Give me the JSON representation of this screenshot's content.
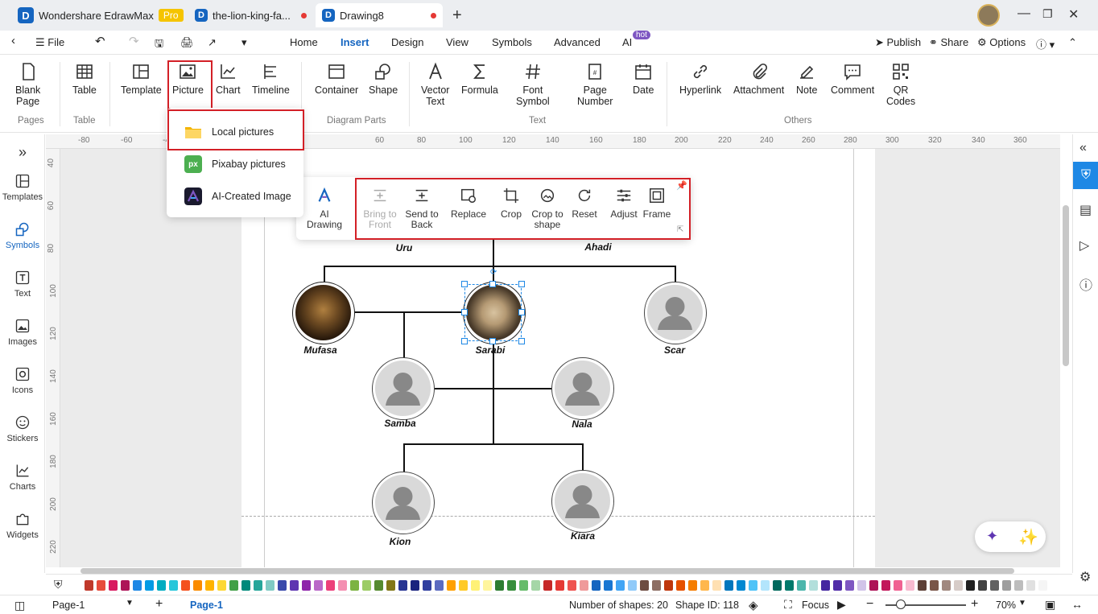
{
  "titlebar": {
    "tabs": [
      {
        "label": "Wondershare EdrawMax",
        "badge": "Pro"
      },
      {
        "label": "the-lion-king-fa..."
      },
      {
        "label": "Drawing8"
      }
    ],
    "add_tab": "+"
  },
  "menubar": {
    "file": "File",
    "items": [
      "Home",
      "Insert",
      "Design",
      "View",
      "Symbols",
      "Advanced",
      "AI"
    ],
    "ai_badge": "hot",
    "publish": "Publish",
    "share": "Share",
    "options": "Options"
  },
  "ribbon": {
    "buttons": {
      "blank_page": "Blank\nPage",
      "table": "Table",
      "template": "Template",
      "picture": "Picture",
      "chart": "Chart",
      "timeline": "Timeline",
      "container": "Container",
      "shape": "Shape",
      "vector_text": "Vector\nText",
      "formula": "Formula",
      "font_symbol": "Font\nSymbol",
      "page_number": "Page\nNumber",
      "date": "Date",
      "hyperlink": "Hyperlink",
      "attachment": "Attachment",
      "note": "Note",
      "comment": "Comment",
      "qr_codes": "QR\nCodes"
    },
    "groups": {
      "pages": "Pages",
      "table": "Table",
      "diagram_parts": "Diagram Parts",
      "text": "Text",
      "others": "Others"
    }
  },
  "picture_menu": {
    "items": [
      "Local pictures",
      "Pixabay pictures",
      "AI-Created Image"
    ]
  },
  "context_toolbar": {
    "ai_drawing": "AI Drawing",
    "bring_to_front": "Bring to\nFront",
    "send_to_back": "Send to\nBack",
    "replace": "Replace",
    "crop": "Crop",
    "crop_to_shape": "Crop to\nshape",
    "reset": "Reset",
    "adjust": "Adjust",
    "frame": "Frame"
  },
  "ruler": {
    "h_ticks": [
      "-80",
      "-60",
      "-4",
      "60",
      "80",
      "100",
      "120",
      "140",
      "160",
      "180",
      "200",
      "220",
      "240",
      "260",
      "280",
      "300",
      "320",
      "340",
      "360"
    ],
    "v_ticks": [
      "40",
      "60",
      "80",
      "100",
      "120",
      "140",
      "160",
      "180",
      "200",
      "220"
    ]
  },
  "left_sidebar": [
    "Templates",
    "Symbols",
    "Text",
    "Images",
    "Icons",
    "Stickers",
    "Charts",
    "Widgets"
  ],
  "diagram": {
    "nodes": [
      "Uru",
      "Ahadi",
      "Mufasa",
      "Sarabi",
      "Scar",
      "Samba",
      "Nala",
      "Kion",
      "Kiara"
    ]
  },
  "statusbar": {
    "page_select": "Page-1",
    "page_tab": "Page-1",
    "shape_count": "Number of shapes: 20",
    "shape_id": "Shape ID: 118",
    "focus": "Focus",
    "zoom": "70%"
  },
  "colors": {
    "accent": "#1565c0",
    "highlight": "#d32027",
    "palette": [
      "#c0392b",
      "#e74c3c",
      "#d81b60",
      "#ad1457",
      "#1e88e5",
      "#039be5",
      "#00acc1",
      "#26c6da",
      "#f4511e",
      "#fb8c00",
      "#ffb300",
      "#fdd835",
      "#43a047",
      "#00897b",
      "#26a69a",
      "#80cbc4",
      "#3949ab",
      "#5e35b1",
      "#8e24aa",
      "#ba68c8",
      "#ec407a",
      "#f48fb1",
      "#7cb342",
      "#9ccc65",
      "#558b2f",
      "#827717",
      "#283593",
      "#1a237e",
      "#303f9f",
      "#5c6bc0",
      "#ffa000",
      "#ffca28",
      "#fff176",
      "#fff59d",
      "#2e7d32",
      "#388e3c",
      "#66bb6a",
      "#a5d6a7",
      "#c62828",
      "#e53935",
      "#ef5350",
      "#ef9a9a",
      "#1565c0",
      "#1976d2",
      "#42a5f5",
      "#90caf9",
      "#6d4c41",
      "#8d6e63",
      "#bf360c",
      "#e65100",
      "#f57c00",
      "#ffb74d",
      "#ffe0b2",
      "#0277bd",
      "#0288d1",
      "#4fc3f7",
      "#b3e5fc",
      "#00695c",
      "#00796b",
      "#4db6ac",
      "#b2dfdb",
      "#4527a0",
      "#512da8",
      "#7e57c2",
      "#d1c4e9",
      "#ad1457",
      "#c2185b",
      "#f06292",
      "#f8bbd0",
      "#5d4037",
      "#795548",
      "#a1887f",
      "#d7ccc8",
      "#212121",
      "#424242",
      "#616161",
      "#9e9e9e",
      "#bdbdbd",
      "#e0e0e0",
      "#f5f5f5"
    ]
  }
}
